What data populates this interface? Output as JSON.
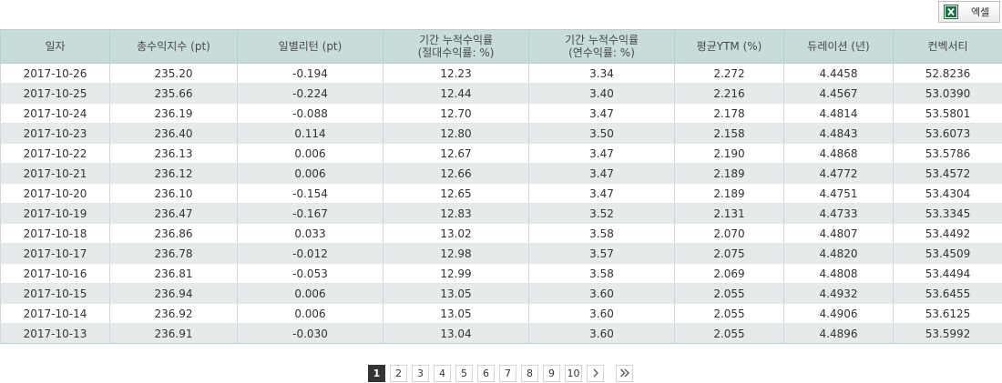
{
  "toolbar": {
    "excel_label": "엑셀",
    "excel_icon": "excel-icon"
  },
  "table": {
    "columns": [
      {
        "line1": "일자",
        "line2": ""
      },
      {
        "line1": "총수익지수 (pt)",
        "line2": ""
      },
      {
        "line1": "일별리턴 (pt)",
        "line2": ""
      },
      {
        "line1": "기간 누적수익률",
        "line2": "(절대수익률: %)"
      },
      {
        "line1": "기간 누적수익률",
        "line2": "(연수익률: %)"
      },
      {
        "line1": "평균YTM (%)",
        "line2": ""
      },
      {
        "line1": "듀레이션 (년)",
        "line2": ""
      },
      {
        "line1": "컨벡서티",
        "line2": ""
      }
    ],
    "rows": [
      [
        "2017-10-26",
        "235.20",
        "-0.194",
        "12.23",
        "3.34",
        "2.272",
        "4.4458",
        "52.8236"
      ],
      [
        "2017-10-25",
        "235.66",
        "-0.224",
        "12.44",
        "3.40",
        "2.216",
        "4.4567",
        "53.0390"
      ],
      [
        "2017-10-24",
        "236.19",
        "-0.088",
        "12.70",
        "3.47",
        "2.178",
        "4.4814",
        "53.5801"
      ],
      [
        "2017-10-23",
        "236.40",
        "0.114",
        "12.80",
        "3.50",
        "2.158",
        "4.4843",
        "53.6073"
      ],
      [
        "2017-10-22",
        "236.13",
        "0.006",
        "12.67",
        "3.47",
        "2.190",
        "4.4868",
        "53.5786"
      ],
      [
        "2017-10-21",
        "236.12",
        "0.006",
        "12.66",
        "3.47",
        "2.189",
        "4.4772",
        "53.4572"
      ],
      [
        "2017-10-20",
        "236.10",
        "-0.154",
        "12.65",
        "3.47",
        "2.189",
        "4.4751",
        "53.4304"
      ],
      [
        "2017-10-19",
        "236.47",
        "-0.167",
        "12.83",
        "3.52",
        "2.131",
        "4.4733",
        "53.3345"
      ],
      [
        "2017-10-18",
        "236.86",
        "0.033",
        "13.02",
        "3.58",
        "2.070",
        "4.4807",
        "53.4492"
      ],
      [
        "2017-10-17",
        "236.78",
        "-0.012",
        "12.98",
        "3.57",
        "2.075",
        "4.4820",
        "53.4509"
      ],
      [
        "2017-10-16",
        "236.81",
        "-0.053",
        "12.99",
        "3.58",
        "2.069",
        "4.4808",
        "53.4494"
      ],
      [
        "2017-10-15",
        "236.94",
        "0.006",
        "13.05",
        "3.60",
        "2.055",
        "4.4932",
        "53.6455"
      ],
      [
        "2017-10-14",
        "236.92",
        "0.006",
        "13.05",
        "3.60",
        "2.055",
        "4.4906",
        "53.6125"
      ],
      [
        "2017-10-13",
        "236.91",
        "-0.030",
        "13.04",
        "3.60",
        "2.055",
        "4.4896",
        "53.5992"
      ]
    ]
  },
  "pagination": {
    "pages": [
      "1",
      "2",
      "3",
      "4",
      "5",
      "6",
      "7",
      "8",
      "9",
      "10"
    ],
    "current": "1",
    "next_icon": "chevron-right-icon",
    "last_icon": "double-chevron-right-icon"
  },
  "colors": {
    "header_bg": "#c9dcdc",
    "row_alt_bg": "#e6eaea",
    "active_page_bg": "#333333",
    "excel_green": "#1e7145"
  }
}
